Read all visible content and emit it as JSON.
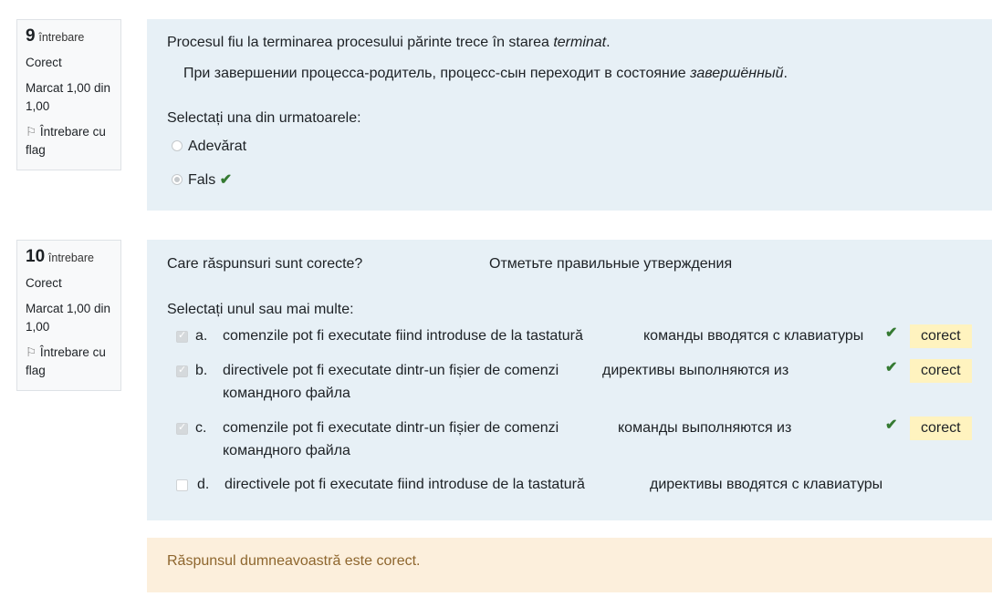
{
  "q9": {
    "info": {
      "number": "9",
      "label": "întrebare",
      "status": "Corect",
      "mark": "Marcat 1,00 din 1,00",
      "flag": "Întrebare cu flag"
    },
    "text_prefix": "Procesul fiu la terminarea procesului părinte trece  în starea ",
    "text_em": "terminat",
    "text_suffix": ".",
    "translation_prefix": "При завершении процесса-родитель, процесс-сын переходит в состояние ",
    "translation_em": "завершённый",
    "translation_suffix": ".",
    "prompt": "Selectați una din urmatoarele:",
    "options": [
      {
        "label": "Adevărat",
        "selected": false
      },
      {
        "label": "Fals",
        "selected": true,
        "correct": true
      }
    ]
  },
  "q10": {
    "info": {
      "number": "10",
      "label": "întrebare",
      "status": "Corect",
      "mark": "Marcat 1,00 din 1,00",
      "flag": "Întrebare cu flag"
    },
    "text": "Care răspunsuri sunt corecte?",
    "translation": "Отметьте правильные утверждения",
    "prompt": "Selectați unul sau mai multe:",
    "options": [
      {
        "letter": "a.",
        "text": "comenzile pot fi executate fiind introduse de la tastatură",
        "translation": "команды вводятся с клавиатуры",
        "checked": true,
        "badge": "corect"
      },
      {
        "letter": "b.",
        "text": "directivele pot fi executate dintr-un fișier de comenzi",
        "translation": "директивы выполняются  из",
        "translation2": "командного файла",
        "checked": true,
        "badge": "corect"
      },
      {
        "letter": "c.",
        "text": "comenzile pot fi executate dintr-un fișier de comenzi",
        "translation": "команды выполняются  из",
        "translation2": "командного файла",
        "checked": true,
        "badge": "corect"
      },
      {
        "letter": "d.",
        "text": "directivele pot fi executate fiind introduse de la tastatură",
        "translation": "директивы вводятся с клавиатуры",
        "checked": false
      }
    ],
    "feedback": "Răspunsul dumneavoastră este corect."
  },
  "colors": {
    "question_bg": "#e7f0f6",
    "feedback_bg": "#fcefdc",
    "feedback_text": "#8e662e",
    "correct_check": "#357a32",
    "badge_bg": "#fff3bf"
  }
}
